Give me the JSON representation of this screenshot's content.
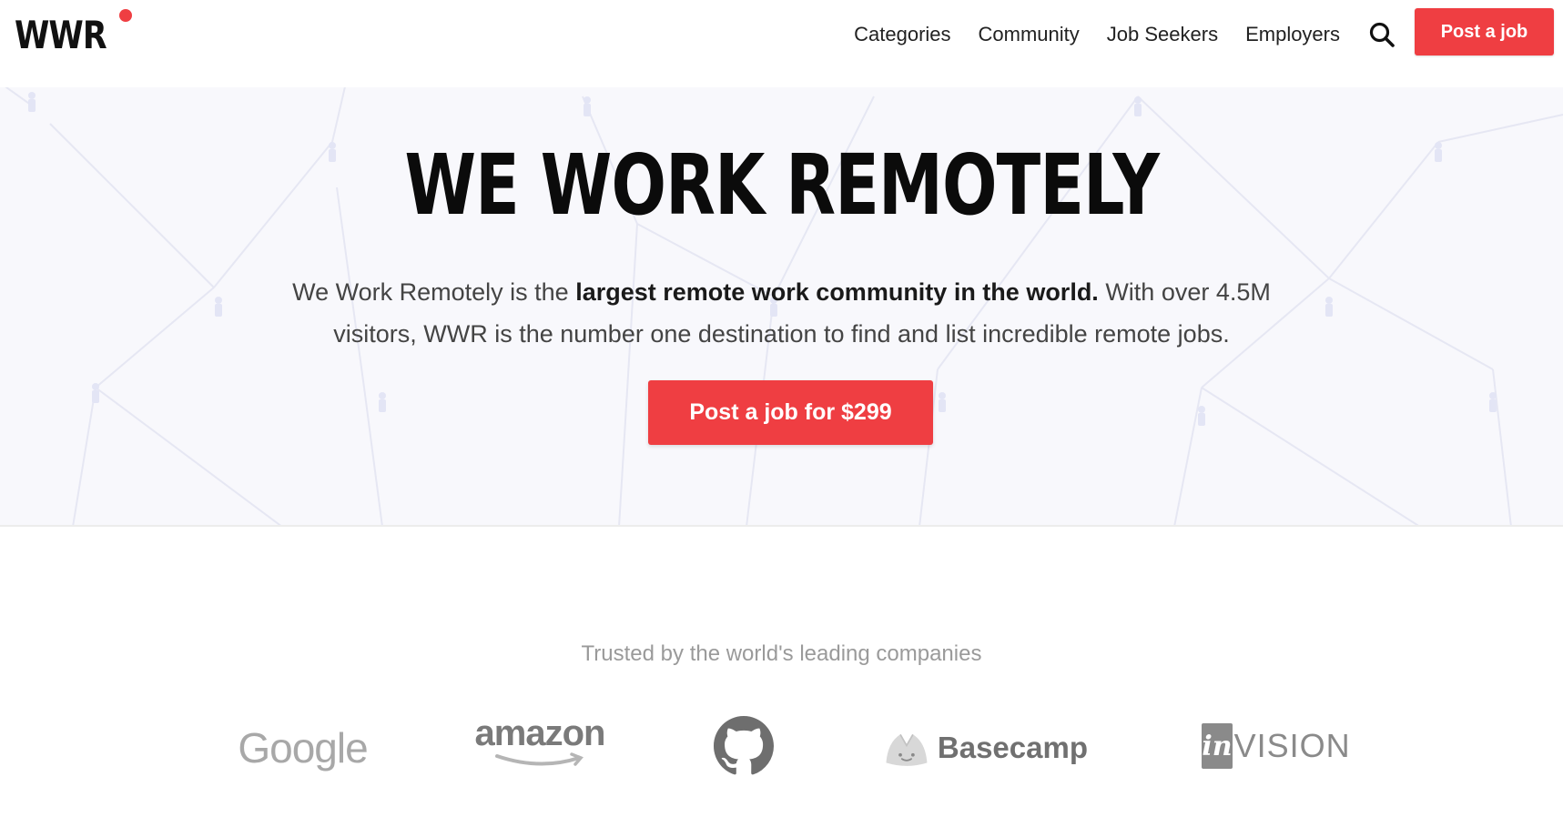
{
  "header": {
    "logo_text": "WWR",
    "nav": [
      {
        "label": "Categories"
      },
      {
        "label": "Community"
      },
      {
        "label": "Job Seekers"
      },
      {
        "label": "Employers"
      }
    ],
    "search_icon": "search-icon",
    "post_job_label": "Post a job"
  },
  "hero": {
    "title": "WE WORK REMOTELY",
    "text_before": "We Work Remotely is the ",
    "text_bold": "largest remote work community in the world.",
    "text_after": " With over 4.5M visitors, WWR is the number one destination to find and list incredible remote jobs.",
    "cta_label": "Post a job for $299"
  },
  "trusted": {
    "heading": "Trusted by the world's leading companies",
    "logos": [
      {
        "name": "Google",
        "text": "Google"
      },
      {
        "name": "Amazon",
        "text": "amazon"
      },
      {
        "name": "GitHub",
        "icon": "github-icon"
      },
      {
        "name": "Basecamp",
        "text": "Basecamp"
      },
      {
        "name": "InVision",
        "box_text": "in",
        "text": "VISION"
      }
    ]
  },
  "colors": {
    "accent": "#ef3e42",
    "hero_bg": "#f8f8fc",
    "text": "#222222",
    "muted": "#9a9a9a"
  }
}
